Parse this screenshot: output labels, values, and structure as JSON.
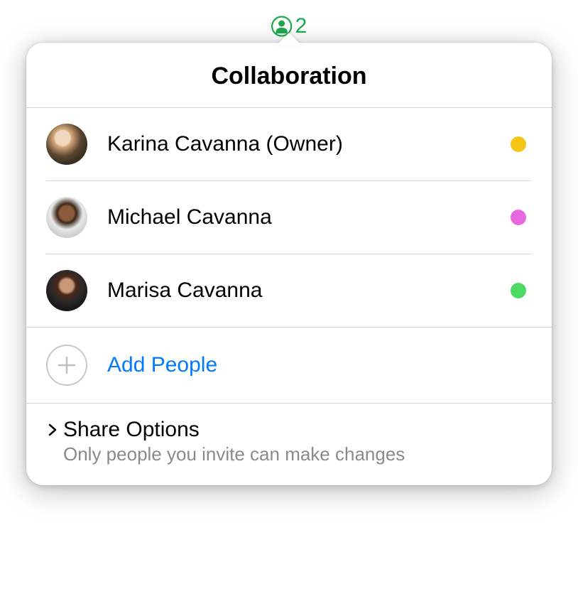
{
  "badge": {
    "count": "2"
  },
  "popover": {
    "title": "Collaboration",
    "collaborators": [
      {
        "name": "Karina Cavanna (Owner)",
        "statusColor": "#f5c518"
      },
      {
        "name": "Michael Cavanna",
        "statusColor": "#e868e0"
      },
      {
        "name": "Marisa Cavanna",
        "statusColor": "#4cd964"
      }
    ],
    "addPeople": {
      "label": "Add People"
    },
    "shareOptions": {
      "title": "Share Options",
      "subtitle": "Only people you invite can make changes"
    }
  }
}
